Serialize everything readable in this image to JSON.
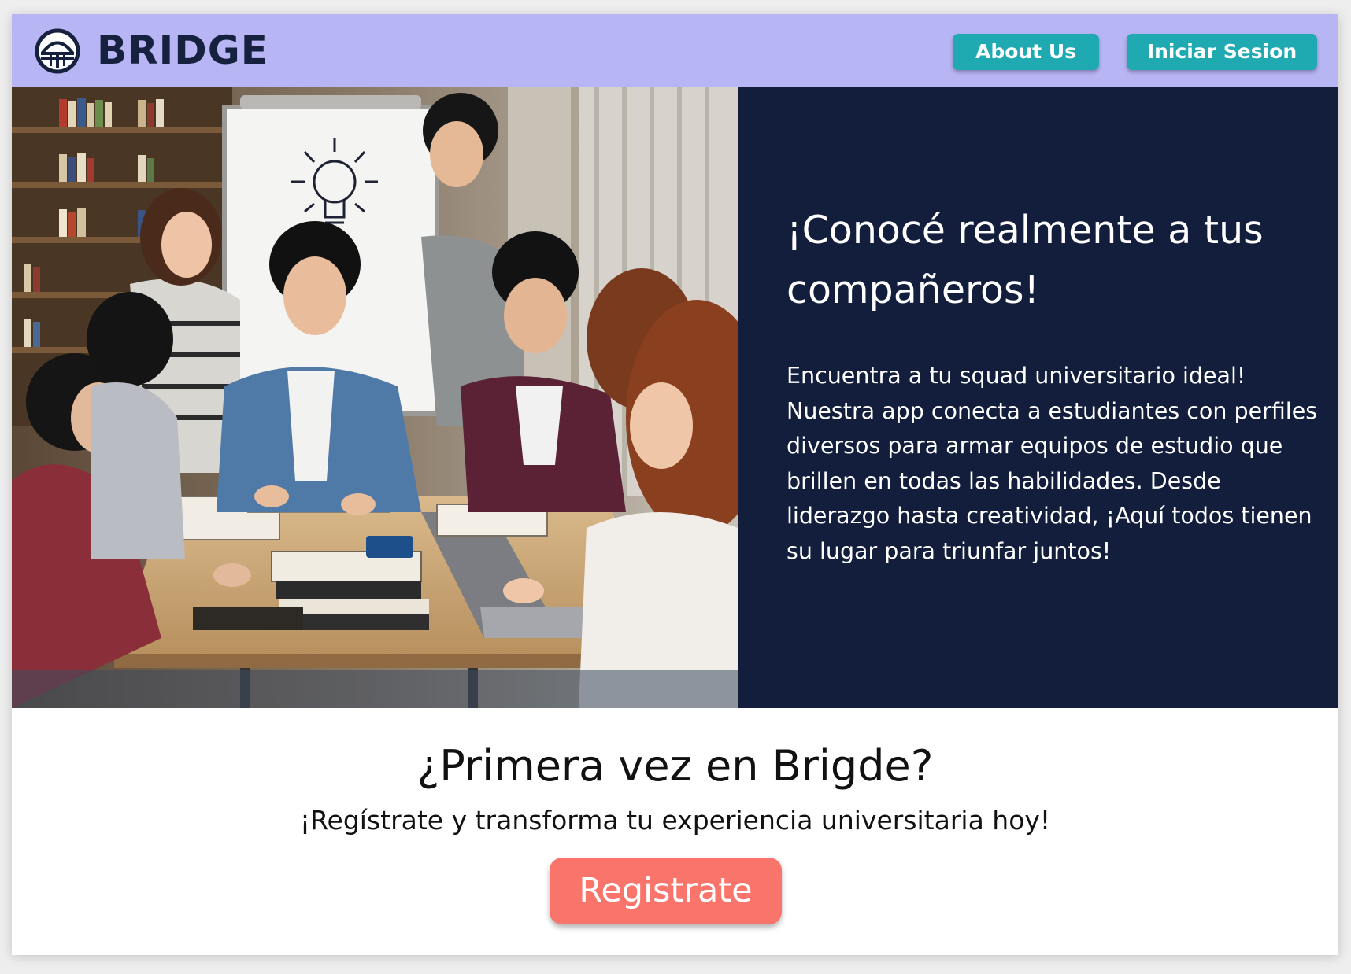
{
  "header": {
    "brand": "BRIDGE",
    "logo_icon": "bridge-logo-icon",
    "about_label": "About Us",
    "login_label": "Iniciar Sesion"
  },
  "hero": {
    "image_icon": "students-study-group-photo",
    "title": "¡Conocé realmente a tus compañeros!",
    "body": "Encuentra a tu squad universitario ideal! Nuestra app conecta a estudiantes con perfiles diversos para armar equipos de estudio que brillen en todas las habilidades. Desde liderazgo hasta creatividad, ¡Aquí todos tienen su lugar para triunfar juntos!"
  },
  "cta": {
    "title": "¿Primera vez en Brigde?",
    "subtitle": "¡Regístrate y transforma tu experiencia universitaria hoy!",
    "register_label": "Registrate"
  },
  "colors": {
    "navbar": "#b8b5f5",
    "brand_text": "#16213f",
    "nav_button": "#1eaab0",
    "hero_panel": "#131e3d",
    "register_button": "#f9746a"
  }
}
